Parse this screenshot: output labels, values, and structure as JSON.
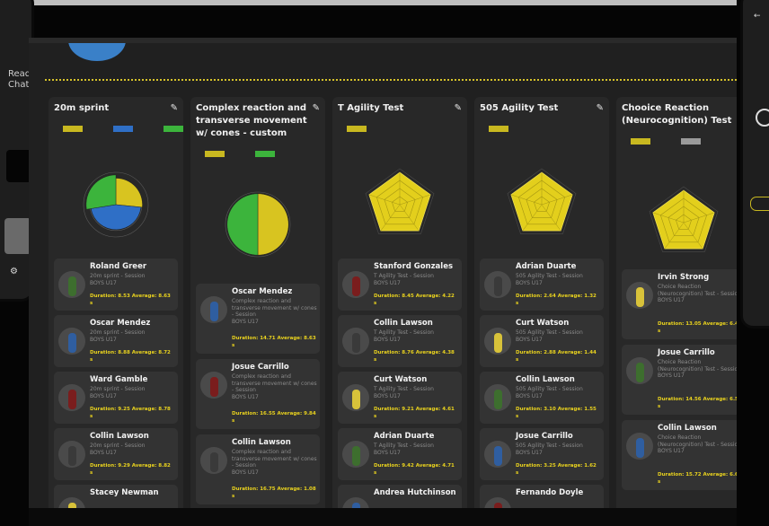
{
  "left_phone": {
    "line1": "Read",
    "line2": "Chat"
  },
  "colors": {
    "accent": "#e9d21e",
    "green": "#3cb43c",
    "blue": "#2f6fc6",
    "card": "#333333"
  },
  "columns": [
    {
      "title": "20m sprint",
      "legend": [
        {
          "color": "#c8b820"
        },
        {
          "color": "#2f6fc6"
        },
        {
          "color": "#3cb43c"
        }
      ],
      "radar": "mixed",
      "cards": [
        {
          "name": "Roland Greer",
          "sub": "20m sprint - Session",
          "team": "BOYS U17",
          "stats": "Duration: 8.53   Average: 8.63",
          "extra": "s"
        },
        {
          "name": "Oscar Mendez",
          "sub": "20m sprint - Session",
          "team": "BOYS U17",
          "stats": "Duration: 8.88   Average: 8.72",
          "extra": "s"
        },
        {
          "name": "Ward  Gamble",
          "sub": "20m sprint - Session",
          "team": "BOYS U17",
          "stats": "Duration: 9.25   Average: 8.78",
          "extra": "s"
        },
        {
          "name": "Collin  Lawson",
          "sub": "20m sprint - Session",
          "team": "BOYS U17",
          "stats": "Duration: 9.29   Average: 8.82",
          "extra": "s"
        },
        {
          "name": "Stacey  Newman",
          "sub": "",
          "team": "",
          "stats": "",
          "extra": ""
        }
      ]
    },
    {
      "title": "Complex reaction and transverse movement w/ cones - custom",
      "legend": [
        {
          "color": "#c8b820"
        },
        {
          "color": "#3cb43c"
        }
      ],
      "radar": "green",
      "cards": [
        {
          "name": "Oscar  Mendez",
          "sub": "Complex reaction and transverse movement w/ cones - Session",
          "team": "BOYS U17",
          "stats": "Duration: 14.71   Average: 8.63",
          "extra": "s"
        },
        {
          "name": "Josue Carrillo",
          "sub": "Complex reaction and transverse movement w/ cones - Session",
          "team": "BOYS U17",
          "stats": "Duration: 16.55   Average: 9.84",
          "extra": "s"
        },
        {
          "name": "Collin  Lawson",
          "sub": "Complex reaction and transverse movement w/ cones - Session",
          "team": "BOYS U17",
          "stats": "Duration: 16.75   Average: 1.08",
          "extra": "s"
        }
      ]
    },
    {
      "title": "T Agility Test",
      "legend": [
        {
          "color": "#c8b820"
        }
      ],
      "radar": "yellow",
      "cards": [
        {
          "name": "Stanford Gonzales",
          "sub": "T Agility Test - Session",
          "team": "BOYS U17",
          "stats": "Duration: 8.45   Average: 4.22",
          "extra": "s"
        },
        {
          "name": "Collin  Lawson",
          "sub": "T Agility Test - Session",
          "team": "BOYS U17",
          "stats": "Duration: 8.76   Average: 4.38",
          "extra": "s"
        },
        {
          "name": "Curt Watson",
          "sub": "T Agility Test - Session",
          "team": "BOYS U17",
          "stats": "Duration: 9.21   Average: 4.61",
          "extra": "s"
        },
        {
          "name": "Adrian Duarte",
          "sub": "T Agility Test - Session",
          "team": "BOYS U17",
          "stats": "Duration: 9.42   Average: 4.71",
          "extra": "s"
        },
        {
          "name": "Andrea  Hutchinson",
          "sub": "",
          "team": "",
          "stats": "",
          "extra": ""
        }
      ]
    },
    {
      "title": "505 Agility Test",
      "legend": [
        {
          "color": "#c8b820"
        }
      ],
      "radar": "yellow",
      "cards": [
        {
          "name": "Adrian Duarte",
          "sub": "505 Agility Test - Session",
          "team": "BOYS U17",
          "stats": "Duration: 2.64   Average: 1.32",
          "extra": "s"
        },
        {
          "name": "Curt Watson",
          "sub": "505 Agility Test - Session",
          "team": "BOYS U17",
          "stats": "Duration: 2.88   Average: 1.44",
          "extra": "s"
        },
        {
          "name": "Collin  Lawson",
          "sub": "505 Agility Test - Session",
          "team": "BOYS U17",
          "stats": "Duration: 3.10   Average: 1.55",
          "extra": "s"
        },
        {
          "name": "Josue Carrillo",
          "sub": "505 Agility Test - Session",
          "team": "BOYS U17",
          "stats": "Duration: 3.25   Average: 1.62",
          "extra": "s"
        },
        {
          "name": "Fernando Doyle",
          "sub": "",
          "team": "",
          "stats": "",
          "extra": ""
        }
      ]
    },
    {
      "title": "Chooice Reaction (Neurocognition) Test",
      "legend": [
        {
          "color": "#c8b820"
        },
        {
          "color": "#9a9a9a"
        }
      ],
      "radar": "yellow",
      "cards": [
        {
          "name": "Irvin Strong",
          "sub": "Choice Reaction (Neurocognition) Test - Session",
          "team": "BOYS U17",
          "stats": "Duration: 13.05   Average: 6.40",
          "extra": "s"
        },
        {
          "name": "Josue Carrillo",
          "sub": "Choice Reaction (Neurocognition) Test - Session",
          "team": "BOYS U17",
          "stats": "Duration: 14.56   Average: 6.54",
          "extra": "s"
        },
        {
          "name": "Collin  Lawson",
          "sub": "Choice Reaction (Neurocognition) Test - Session",
          "team": "BOYS U17",
          "stats": "Duration: 15.72   Average: 6.68",
          "extra": "s"
        }
      ]
    }
  ]
}
